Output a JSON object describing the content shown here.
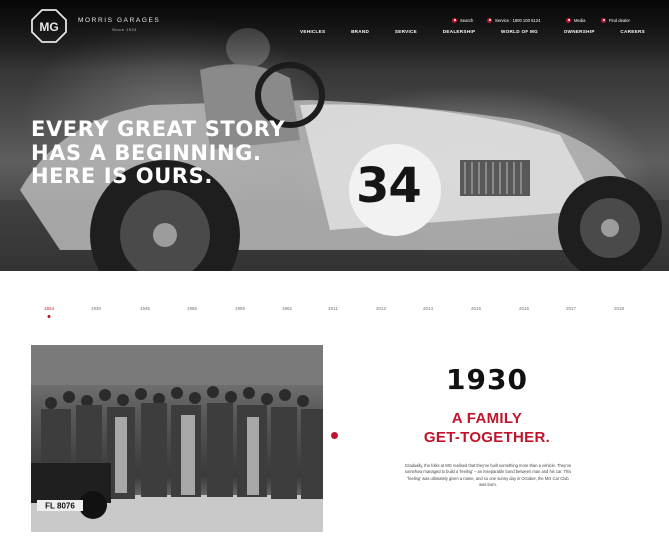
{
  "brand": {
    "logo_text": "MG",
    "name": "MORRIS GARAGES",
    "since": "Since 1924"
  },
  "utility_links": [
    {
      "label": "Search",
      "icon": "search-icon"
    },
    {
      "label": "Service : 1800 100 6124",
      "icon": "phone-icon"
    },
    {
      "label": "Media",
      "icon": "media-icon"
    },
    {
      "label": "Find dealer",
      "icon": "location-pin-icon"
    }
  ],
  "nav": [
    "VEHICLES",
    "BRAND",
    "SERVICE",
    "DEALERSHIP",
    "WORLD OF MG",
    "OWNERSHIP",
    "CAREERS"
  ],
  "hero": {
    "headline": [
      "EVERY GREAT STORY",
      "HAS A BEGINNING.",
      "HERE IS OURS."
    ],
    "car_number": "34"
  },
  "timeline": {
    "years": [
      "1924",
      "1930",
      "1945",
      "1955",
      "1959",
      "1962",
      "2011",
      "2012",
      "2014",
      "2015",
      "2016",
      "2017",
      "2018"
    ],
    "active": "1924"
  },
  "photo": {
    "plate_text": "FL 8076"
  },
  "story": {
    "year": "1930",
    "title": [
      "A FAMILY",
      "GET-TOGETHER."
    ],
    "body": "Gradually, the folks at MG realised that they've built something more than a vehicle. They've somehow managed to build a 'feeling' – an inseparable bond between man and his car. This 'feeling' was ultimately given a name, and so one sunny day in October, the MG Car Club was born."
  },
  "colors": {
    "accent": "#c0142c",
    "text_dark": "#111111",
    "hero_text": "#ffffff"
  }
}
